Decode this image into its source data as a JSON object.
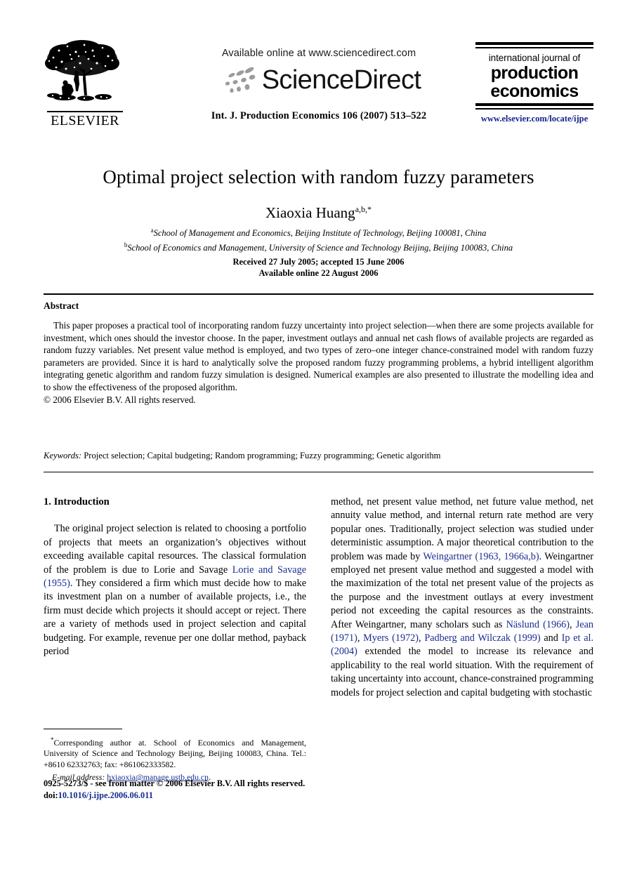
{
  "masthead": {
    "publisher_name": "ELSEVIER",
    "publisher_logo_icon": "elsevier-tree-icon",
    "available_online": "Available online at www.sciencedirect.com",
    "sciencedirect_wordmark": "ScienceDirect",
    "sciencedirect_dots_icon": "sciencedirect-dots-icon",
    "journal_reference": "Int. J. Production Economics 106 (2007) 513–522",
    "journal_logo": {
      "line1": "international journal of",
      "line2": "production",
      "line3": "economics",
      "url": "www.elsevier.com/locate/ijpe",
      "url_color": "#14248a"
    }
  },
  "article": {
    "title": "Optimal project selection with random fuzzy parameters",
    "author": "Xiaoxia Huang",
    "author_superscript": "a,b,*",
    "affiliations": [
      {
        "marker": "a",
        "text": "School of Management and Economics, Beijing Institute of Technology, Beijing 100081, China"
      },
      {
        "marker": "b",
        "text": "School of Economics and Management, University of Science and Technology Beijing, Beijing 100083, China"
      }
    ],
    "history_line1": "Received 27 July 2005; accepted 15 June 2006",
    "history_line2": "Available online 22 August 2006"
  },
  "abstract": {
    "heading": "Abstract",
    "paragraph": "This paper proposes a practical tool of incorporating random fuzzy uncertainty into project selection—when there are some projects available for investment, which ones should the investor choose. In the paper, investment outlays and annual net cash flows of available projects are regarded as random fuzzy variables. Net present value method is employed, and two types of zero–one integer chance-constrained model with random fuzzy parameters are provided. Since it is hard to analytically solve the proposed random fuzzy programming problems, a hybrid intelligent algorithm integrating genetic algorithm and random fuzzy simulation is designed. Numerical examples are also presented to illustrate the modelling idea and to show the effectiveness of the proposed algorithm.",
    "copyright": "© 2006 Elsevier B.V. All rights reserved."
  },
  "keywords": {
    "label": "Keywords:",
    "value": " Project selection; Capital budgeting; Random programming; Fuzzy programming; Genetic algorithm"
  },
  "body": {
    "section_heading": "1. Introduction",
    "left_column": {
      "part1": "The original project selection is related to choosing a portfolio of projects that meets an organization’s objectives without exceeding available capital resources. The classical formulation of the problem is due to Lorie and Savage ",
      "cite1": "Lorie and Savage (1955)",
      "part2": ". They considered a firm which must decide how to make its investment plan on a number of available projects, i.e., the firm must decide which projects it should accept or reject. There are a variety of methods used in project selection and capital budgeting. For example, revenue per one dollar method, payback period"
    },
    "right_column": {
      "part1": "method, net present value method, net future value method, net annuity value method, and internal return rate method are very popular ones. Traditionally, project selection was studied under deterministic assumption. A major theoretical contribution to the problem was made by ",
      "cite1": "Weingartner (1963, 1966a,b)",
      "part2": ". Weingartner employed net present value method and suggested a model with the maximization of the total net present value of the projects as the purpose and the investment outlays at every investment period not exceeding the capital resources as the constraints. After Weingartner, many scholars such as ",
      "cite2": "Näslund (1966)",
      "sep2": ", ",
      "cite3": "Jean (1971)",
      "sep3": ", ",
      "cite4": "Myers (1972)",
      "sep4": ", ",
      "cite5": "Padberg and Wilczak (1999)",
      "sep5": " and ",
      "cite6": "Ip et al. (2004)",
      "part3": " extended the model to increase its relevance and applicability to the real world situation. With the requirement of taking uncertainty into account, chance-constrained programming models for project selection and capital budgeting with stochastic"
    }
  },
  "footnote": {
    "marker": "*",
    "text": "Corresponding author at. School of Economics and Management, University of Science and Technology Beijing, Beijing 100083, China. Tel.: +8610 62332763; fax: +861062333582.",
    "email_label": "E-mail address:",
    "email": "hxiaoxia@manage.ustb.edu.cn",
    "email_trailing": "."
  },
  "page_footer": {
    "line1": "0925-5273/$ - see front matter © 2006 Elsevier B.V. All rights reserved.",
    "doi_label": "doi:",
    "doi_value": "10.1016/j.ijpe.2006.06.011"
  },
  "colors": {
    "link_blue": "#1a2d8f",
    "journal_url_blue": "#14248a",
    "text_black": "#000000"
  }
}
